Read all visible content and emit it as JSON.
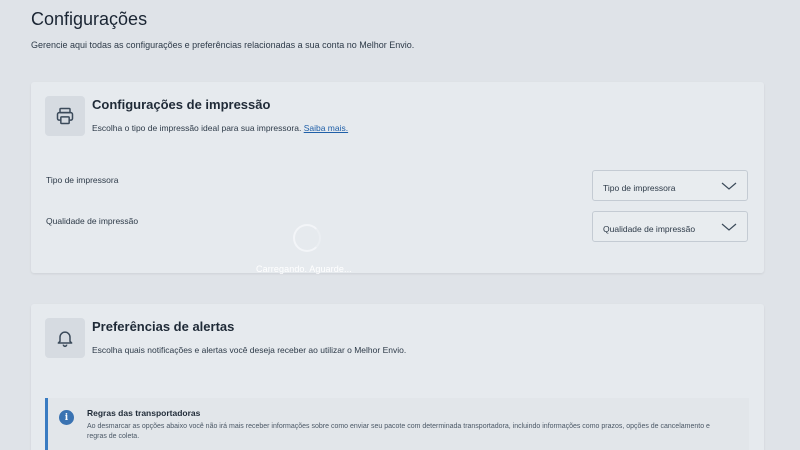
{
  "page": {
    "title": "Configurações",
    "subtitle": "Gerencie aqui todas as configurações e preferências relacionadas a sua conta no Melhor Envio."
  },
  "print_settings": {
    "icon": "printer-icon",
    "title": "Configurações de impressão",
    "description": "Escolha o tipo de impressão ideal para sua impressora.",
    "link_label": "Saiba mais.",
    "fields": [
      {
        "label": "Tipo de impressora",
        "selected": "Tipo de impressora"
      },
      {
        "label": "Qualidade de impressão",
        "selected": "Qualidade de impressão"
      }
    ]
  },
  "loading": {
    "text": "Carregando. Aguarde..."
  },
  "alert_preferences": {
    "icon": "bell-icon",
    "title": "Preferências de alertas",
    "description": "Escolha quais notificações e alertas você deseja receber ao utilizar o Melhor Envio.",
    "info": {
      "icon": "info-icon",
      "title": "Regras das transportadoras",
      "text": "Ao desmarcar as opções abaixo você não irá mais receber informações sobre como enviar seu pacote com determinada transportadora, incluindo informações como prazos, opções de cancelamento e regras de coleta."
    }
  },
  "colors": {
    "background": "#dfe3e8",
    "card": "#e6eaee",
    "link": "#1f5fa8",
    "info_accent": "#3a7cc2"
  }
}
